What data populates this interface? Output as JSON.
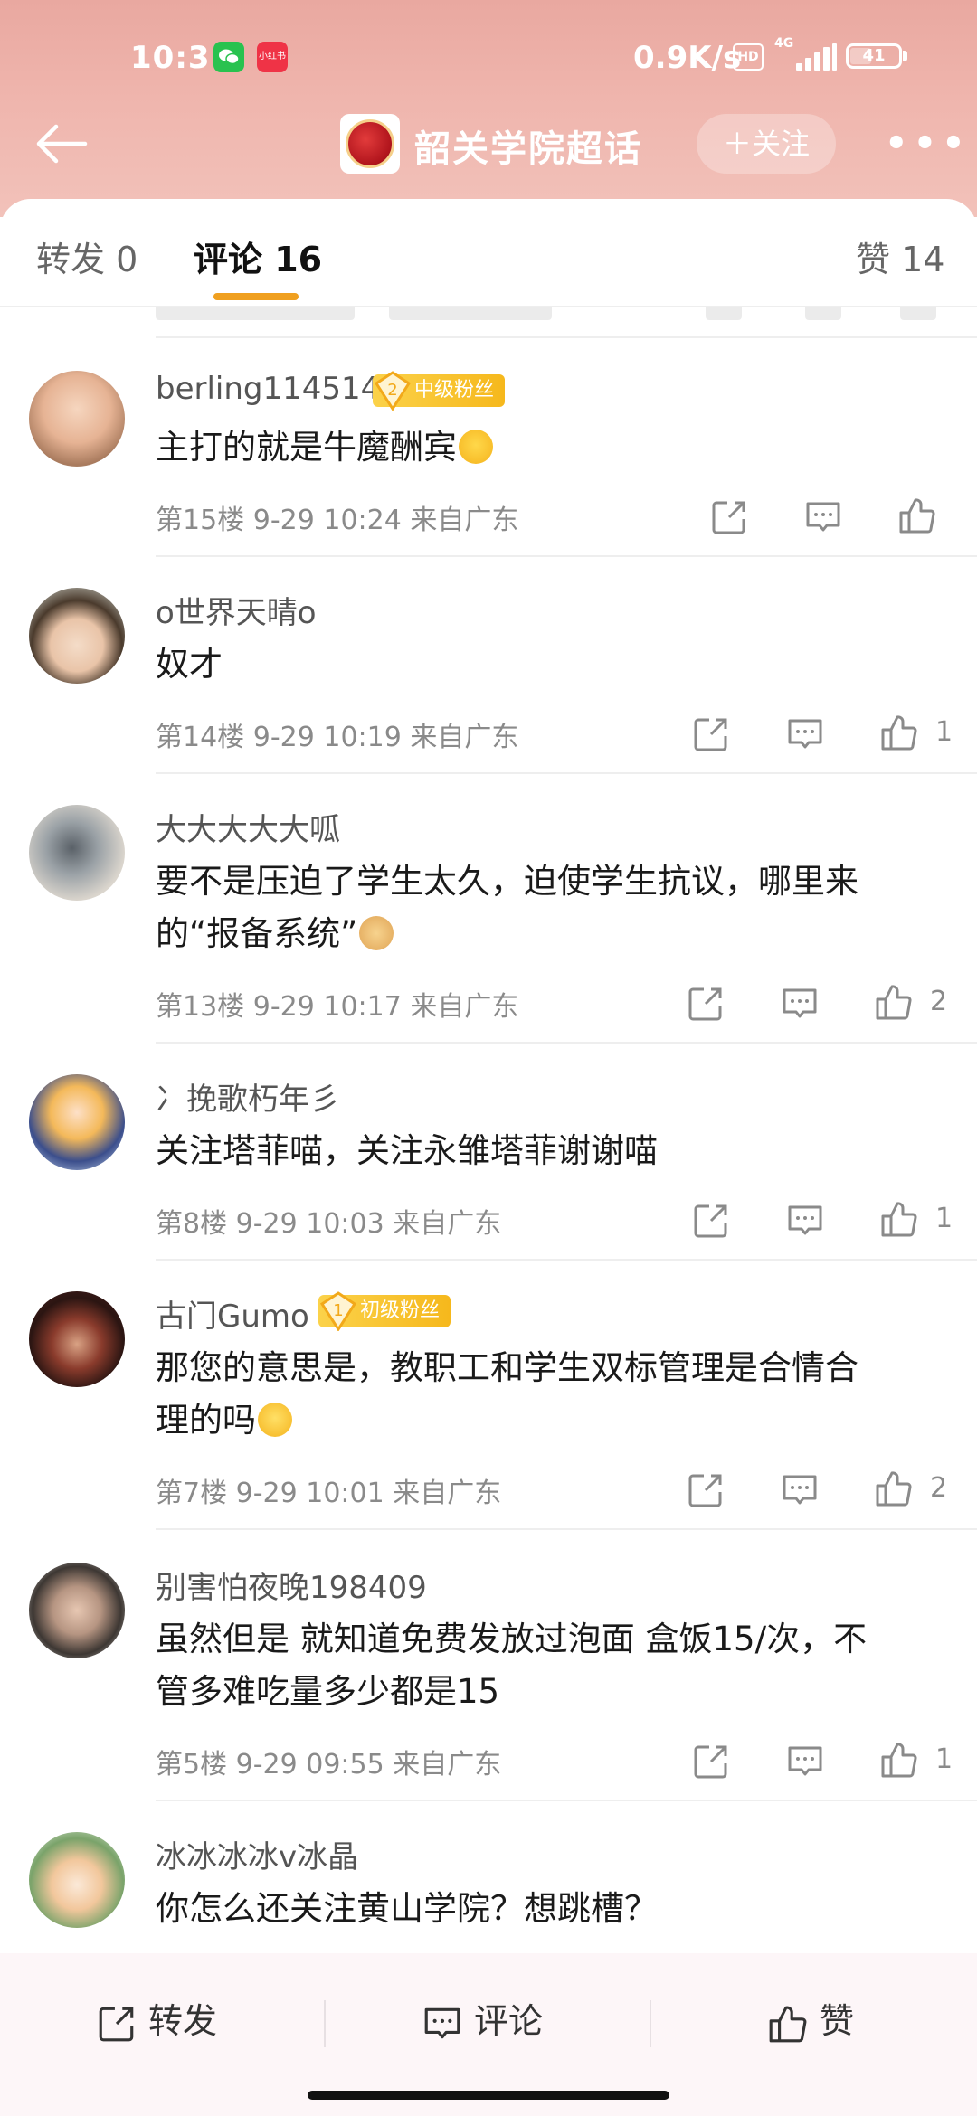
{
  "status_bar": {
    "time": "10:31",
    "app_badge_red": "小红书",
    "net_speed": "0.9K/s",
    "hd": "HD",
    "network": "4G",
    "battery": "41"
  },
  "nav": {
    "title": "韶关学院超话",
    "follow_label": "＋关注",
    "more": "•••"
  },
  "tabs": {
    "repost": "转发 0",
    "comment": "评论 16",
    "like": "赞 14"
  },
  "comments": [
    {
      "username": "berling114514",
      "fan_badge": {
        "level": "2",
        "label": "中级粉丝"
      },
      "text": "主打的就是牛魔酬宾",
      "emoji": "crying-laughing-emoji",
      "floor": "第15楼",
      "date": "9-29 10:24",
      "location": "来自广东",
      "likes": ""
    },
    {
      "username": "o世界天晴o",
      "text": "奴才",
      "floor": "第14楼",
      "date": "9-29 10:19",
      "location": "来自广东",
      "likes": "1"
    },
    {
      "username": "大大大大大呱",
      "text_line1": "要不是压迫了学生太久，迫使学生抗议，哪里来",
      "text_line2": "的“报备系统”",
      "emoji": "doge-emoji",
      "floor": "第13楼",
      "date": "9-29 10:17",
      "location": "来自广东",
      "likes": "2"
    },
    {
      "username": "冫挽歌朽年彡",
      "text": "关注塔菲喵，关注永雏塔菲谢谢喵",
      "floor": "第8楼",
      "date": "9-29 10:03",
      "location": "来自广东",
      "likes": "1"
    },
    {
      "username": "古门Gumo",
      "fan_badge": {
        "level": "1",
        "label": "初级粉丝"
      },
      "text_line1": "那您的意思是，教职工和学生双标管理是合情合",
      "text_line2": "理的吗",
      "emoji": "blush-emoji",
      "floor": "第7楼",
      "date": "9-29 10:01",
      "location": "来自广东",
      "likes": "2"
    },
    {
      "username": "别害怕夜晚198409",
      "text_line1": "虽然但是 就知道免费发放过泡面 盒饭15/次，不",
      "text_line2": "管多难吃量多少都是15",
      "floor": "第5楼",
      "date": "9-29 09:55",
      "location": "来自广东",
      "likes": "1"
    },
    {
      "username": "冰冰冰冰v冰晶",
      "text": "你怎么还关注黄山学院？想跳槽？"
    }
  ],
  "bottom_bar": {
    "repost": "转发",
    "comment": "评论",
    "like": "赞"
  },
  "colors": {
    "header_pink": "#efb5ad",
    "accent_orange": "#f0a020",
    "fan_badge_gold": "#f6b81c"
  }
}
